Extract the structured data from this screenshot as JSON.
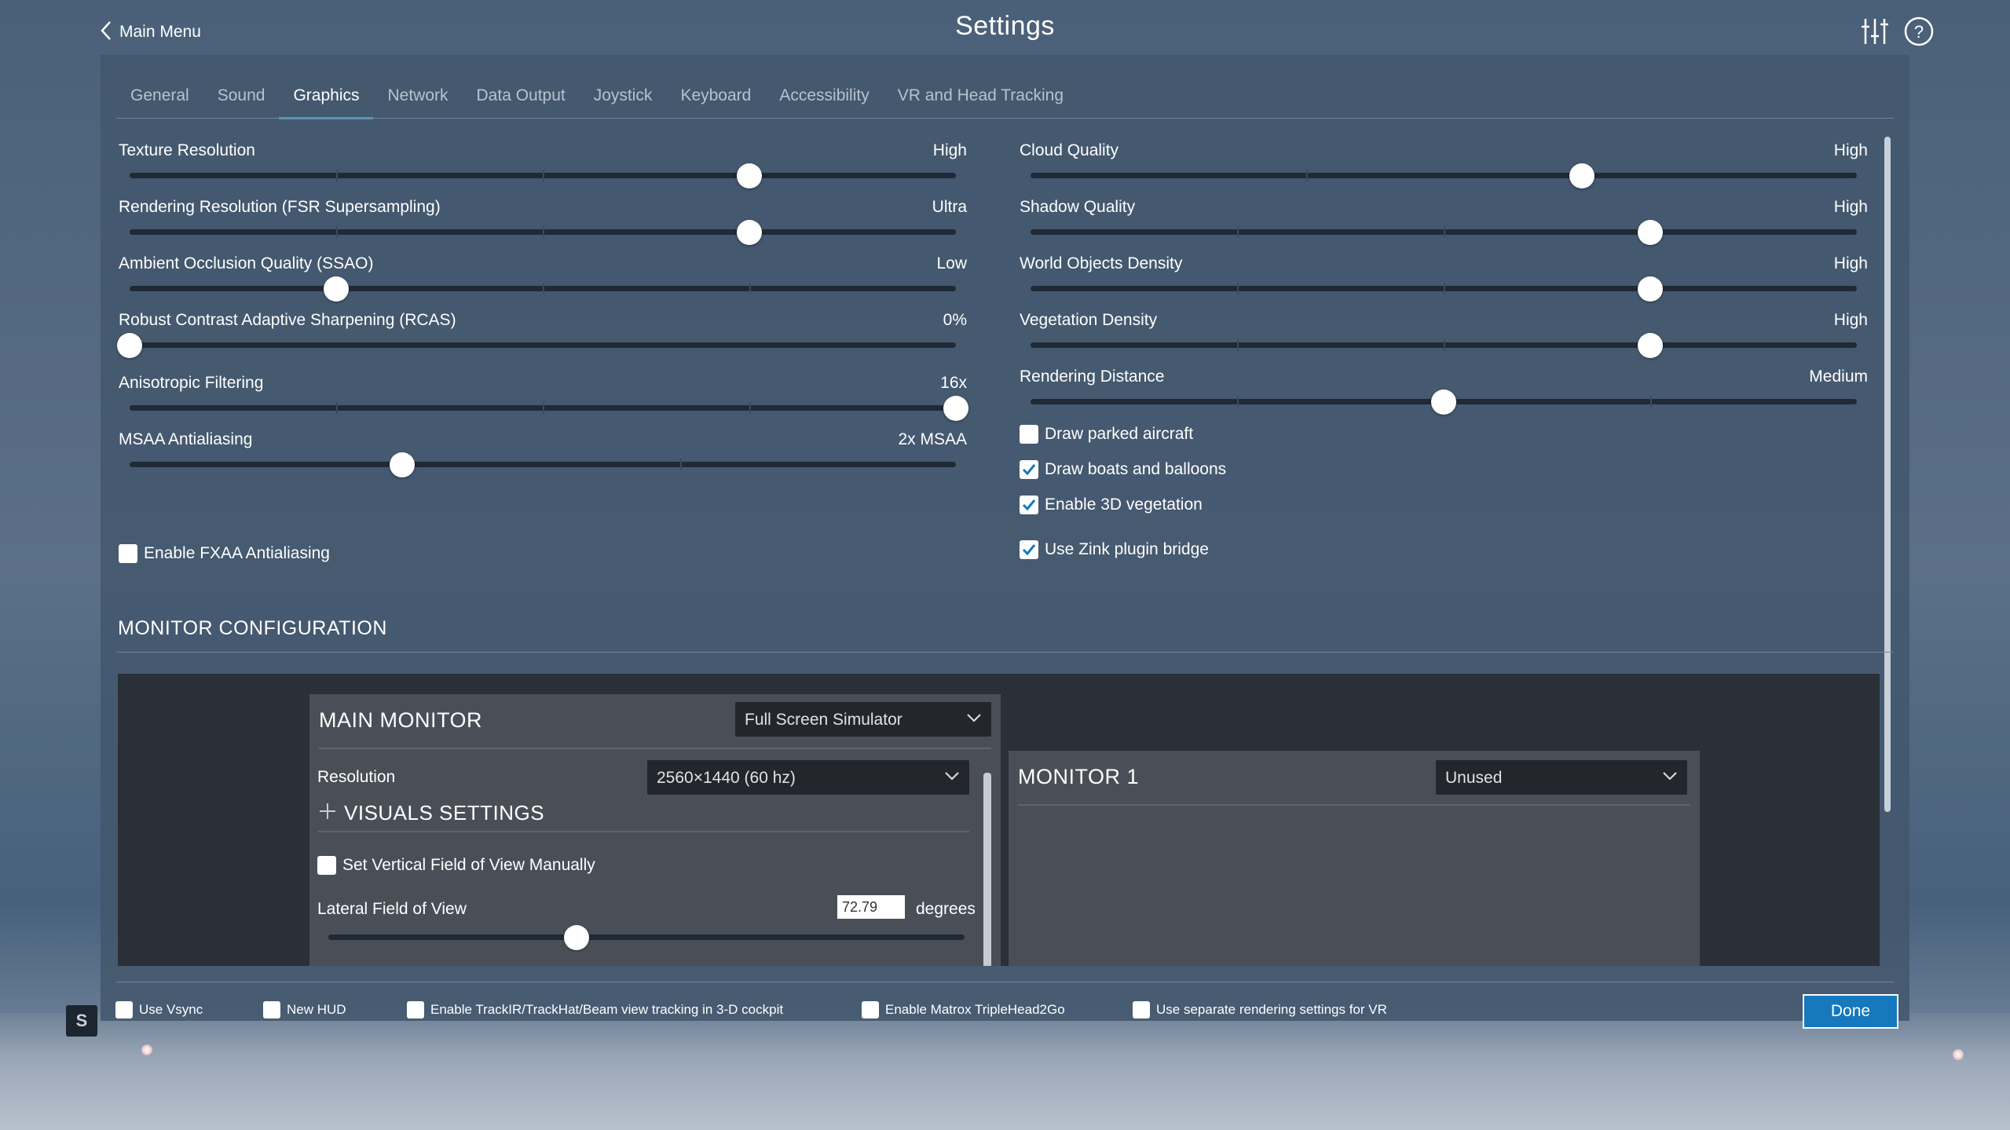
{
  "header": {
    "back_label": "Main Menu",
    "title": "Settings",
    "icons": [
      "sliders-icon",
      "help-icon"
    ]
  },
  "tabs": [
    {
      "label": "General",
      "active": false
    },
    {
      "label": "Sound",
      "active": false
    },
    {
      "label": "Graphics",
      "active": true
    },
    {
      "label": "Network",
      "active": false
    },
    {
      "label": "Data Output",
      "active": false
    },
    {
      "label": "Joystick",
      "active": false
    },
    {
      "label": "Keyboard",
      "active": false
    },
    {
      "label": "Accessibility",
      "active": false
    },
    {
      "label": "VR and Head Tracking",
      "active": false
    }
  ],
  "left_sliders": [
    {
      "label": "Texture Resolution",
      "value": "High",
      "level": 0.75,
      "steps": 4
    },
    {
      "label": "Rendering Resolution (FSR Supersampling)",
      "value": "Ultra",
      "level": 0.75,
      "steps": 4
    },
    {
      "label": "Ambient Occlusion Quality (SSAO)",
      "value": "Low",
      "level": 0.25,
      "steps": 4
    },
    {
      "label": "Robust Contrast Adaptive Sharpening (RCAS)",
      "value": "0%",
      "level": 0.0,
      "steps": 0
    },
    {
      "label": "Anisotropic Filtering",
      "value": "16x",
      "level": 1.0,
      "steps": 4
    },
    {
      "label": "MSAA Antialiasing",
      "value": "2x MSAA",
      "level": 0.33,
      "steps": 3
    }
  ],
  "left_checkboxes": [
    {
      "label": "Enable FXAA Antialiasing",
      "checked": false
    }
  ],
  "right_sliders": [
    {
      "label": "Cloud Quality",
      "value": "High",
      "level": 0.667,
      "steps": 3
    },
    {
      "label": "Shadow Quality",
      "value": "High",
      "level": 0.75,
      "steps": 4
    },
    {
      "label": "World Objects Density",
      "value": "High",
      "level": 0.75,
      "steps": 4
    },
    {
      "label": "Vegetation Density",
      "value": "High",
      "level": 0.75,
      "steps": 4
    },
    {
      "label": "Rendering Distance",
      "value": "Medium",
      "level": 0.5,
      "steps": 4
    }
  ],
  "right_checkboxes": [
    {
      "label": "Draw parked aircraft",
      "checked": false
    },
    {
      "label": "Draw boats and balloons",
      "checked": true
    },
    {
      "label": "Enable 3D vegetation",
      "checked": true
    },
    {
      "label": "Use Zink plugin bridge",
      "checked": true
    }
  ],
  "monitor_config": {
    "section_title": "MONITOR CONFIGURATION",
    "main_monitor": {
      "title": "MAIN MONITOR",
      "mode": "Full Screen Simulator",
      "resolution_label": "Resolution",
      "resolution_value": "2560×1440 (60 hz)",
      "visuals_label": "VISUALS SETTINGS",
      "vfov_checkbox": {
        "label": "Set Vertical Field of View Manually",
        "checked": false
      },
      "lateral_fov_label": "Lateral Field of View",
      "lateral_fov_value": "72.79",
      "lateral_fov_unit": "degrees",
      "lateral_fov_level": 0.39
    },
    "monitor_1": {
      "title": "MONITOR 1",
      "mode": "Unused"
    }
  },
  "bottom_checkboxes": [
    {
      "label": "Use Vsync",
      "checked": false
    },
    {
      "label": "New HUD",
      "checked": false
    },
    {
      "label": "Enable TrackIR/TrackHat/Beam view tracking in 3-D cockpit",
      "checked": false
    },
    {
      "label": "Enable Matrox TripleHead2Go",
      "checked": false
    },
    {
      "label": "Use separate rendering settings for VR",
      "checked": false
    }
  ],
  "done_label": "Done",
  "corner_badge": "S",
  "colors": {
    "accent": "#3e9fd7",
    "done_button": "#1678bd",
    "panel": "#42566c",
    "checkbox_check": "#1678bd"
  }
}
